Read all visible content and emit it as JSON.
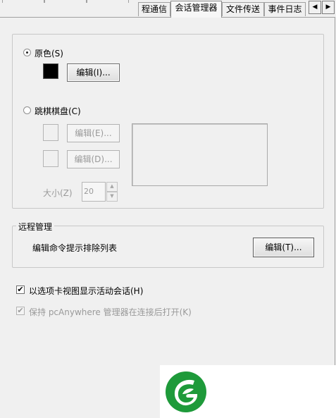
{
  "tabs": [
    {
      "label": "",
      "active": false
    },
    {
      "label": "",
      "active": false
    },
    {
      "label": "程通信",
      "active": false
    },
    {
      "label": "会话管理器",
      "active": true
    },
    {
      "label": "文件传送",
      "active": false
    },
    {
      "label": "事件日志",
      "active": false
    }
  ],
  "tab_scroll": {
    "left_glyph": "◀",
    "right_glyph": "▶"
  },
  "appearance": {
    "original_color": {
      "label": "原色(S)",
      "selected": true,
      "swatch_color": "#000000",
      "edit_button": "编辑(I)..."
    },
    "checkerboard": {
      "label": "跳棋棋盘(C)",
      "selected": false,
      "edit1_button": "编辑(E)...",
      "edit2_button": "编辑(D)...",
      "size_label": "大小(Z)",
      "size_value": "20"
    }
  },
  "remote_management": {
    "title": "远程管理",
    "description": "编辑命令提示排除列表",
    "edit_button": "编辑(T)..."
  },
  "options": {
    "show_tabs": {
      "label": "以选项卡视图显示活动会话(H)",
      "checked": true,
      "check_glyph": "✔"
    },
    "keep_open": {
      "label": "保持 pcAnywhere 管理器在连接后打开(K)",
      "checked": true,
      "disabled": true,
      "check_glyph": "✔"
    }
  },
  "colors": {
    "logo_green": "#1e9a3a",
    "panel_bg": "#f0f0f0"
  },
  "logo": {
    "name": "green-leaf-logo"
  }
}
